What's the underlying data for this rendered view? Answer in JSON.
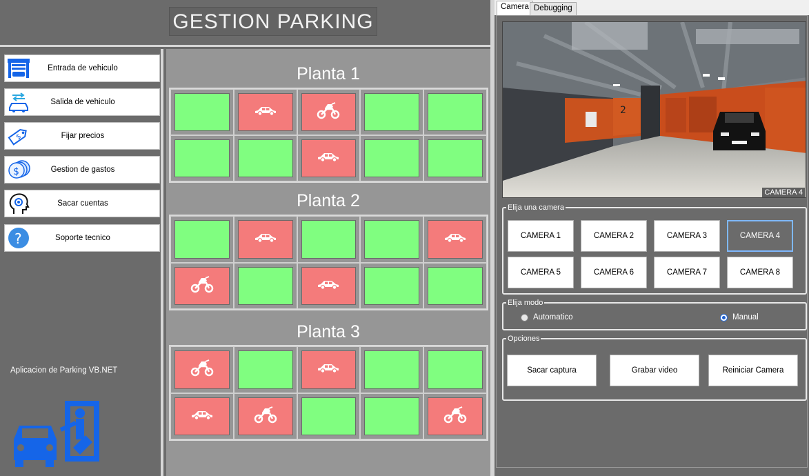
{
  "app": {
    "title": "GESTION PARKING",
    "caption": "Aplicacion de Parking VB.NET"
  },
  "sidebar": {
    "items": [
      {
        "label": "Entrada de vehiculo",
        "icon": "garage-car-icon"
      },
      {
        "label": "Salida de vehiculo",
        "icon": "car-exit-arrows-icon"
      },
      {
        "label": "Fijar precios",
        "icon": "price-tag-icon"
      },
      {
        "label": "Gestion de gastos",
        "icon": "coins-icon"
      },
      {
        "label": "Sacar cuentas",
        "icon": "head-gear-icon"
      },
      {
        "label": "Soporte tecnico",
        "icon": "question-icon"
      }
    ]
  },
  "floors": [
    {
      "title": "Planta 1",
      "slots": [
        "free",
        "car",
        "moto",
        "free",
        "free",
        "free",
        "free",
        "car",
        "free",
        "free"
      ]
    },
    {
      "title": "Planta 2",
      "slots": [
        "free",
        "car",
        "free",
        "free",
        "car",
        "moto",
        "free",
        "car",
        "free",
        "free"
      ]
    },
    {
      "title": "Planta 3",
      "slots": [
        "moto",
        "free",
        "car",
        "free",
        "free",
        "car",
        "moto",
        "free",
        "free",
        "moto"
      ]
    }
  ],
  "colors": {
    "free": "#80fe80",
    "taken": "#f47b7b",
    "accent_selected": "#7fb8ff"
  },
  "tabs": [
    {
      "label": "Camera",
      "active": true
    },
    {
      "label": "Debugging",
      "active": false
    }
  ],
  "camera": {
    "overlay_label": "CAMERA 4",
    "group_label": "Elija una camera",
    "buttons": [
      "CAMERA 1",
      "CAMERA 2",
      "CAMERA 3",
      "CAMERA 4",
      "CAMERA 5",
      "CAMERA 6",
      "CAMERA 7",
      "CAMERA 8"
    ],
    "selected": "CAMERA 4"
  },
  "mode": {
    "group_label": "Elija modo",
    "options": [
      {
        "label": "Automatico",
        "checked": false
      },
      {
        "label": "Manual",
        "checked": true
      }
    ]
  },
  "options": {
    "group_label": "Opciones",
    "buttons": [
      "Sacar captura",
      "Grabar video",
      "Reiniciar Camera"
    ]
  }
}
